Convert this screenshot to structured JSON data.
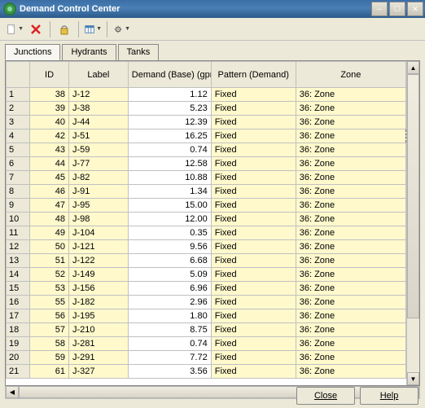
{
  "window": {
    "title": "Demand Control Center"
  },
  "tabs": [
    {
      "label": "Junctions",
      "active": true
    },
    {
      "label": "Hydrants",
      "active": false
    },
    {
      "label": "Tanks",
      "active": false
    }
  ],
  "columns": {
    "id": "ID",
    "label": "Label",
    "demand": "Demand (Base) (gpm)",
    "pattern": "Pattern (Demand)",
    "zone": "Zone"
  },
  "rows": [
    {
      "n": "1",
      "id": "38",
      "label": "J-12",
      "demand": "1.12",
      "pattern": "Fixed",
      "zone": "36: Zone"
    },
    {
      "n": "2",
      "id": "39",
      "label": "J-38",
      "demand": "5.23",
      "pattern": "Fixed",
      "zone": "36: Zone"
    },
    {
      "n": "3",
      "id": "40",
      "label": "J-44",
      "demand": "12.39",
      "pattern": "Fixed",
      "zone": "36: Zone"
    },
    {
      "n": "4",
      "id": "42",
      "label": "J-51",
      "demand": "16.25",
      "pattern": "Fixed",
      "zone": "36: Zone",
      "active": true
    },
    {
      "n": "5",
      "id": "43",
      "label": "J-59",
      "demand": "0.74",
      "pattern": "Fixed",
      "zone": "36: Zone"
    },
    {
      "n": "6",
      "id": "44",
      "label": "J-77",
      "demand": "12.58",
      "pattern": "Fixed",
      "zone": "36: Zone"
    },
    {
      "n": "7",
      "id": "45",
      "label": "J-82",
      "demand": "10.88",
      "pattern": "Fixed",
      "zone": "36: Zone"
    },
    {
      "n": "8",
      "id": "46",
      "label": "J-91",
      "demand": "1.34",
      "pattern": "Fixed",
      "zone": "36: Zone"
    },
    {
      "n": "9",
      "id": "47",
      "label": "J-95",
      "demand": "15.00",
      "pattern": "Fixed",
      "zone": "36: Zone"
    },
    {
      "n": "10",
      "id": "48",
      "label": "J-98",
      "demand": "12.00",
      "pattern": "Fixed",
      "zone": "36: Zone"
    },
    {
      "n": "11",
      "id": "49",
      "label": "J-104",
      "demand": "0.35",
      "pattern": "Fixed",
      "zone": "36: Zone"
    },
    {
      "n": "12",
      "id": "50",
      "label": "J-121",
      "demand": "9.56",
      "pattern": "Fixed",
      "zone": "36: Zone"
    },
    {
      "n": "13",
      "id": "51",
      "label": "J-122",
      "demand": "6.68",
      "pattern": "Fixed",
      "zone": "36: Zone"
    },
    {
      "n": "14",
      "id": "52",
      "label": "J-149",
      "demand": "5.09",
      "pattern": "Fixed",
      "zone": "36: Zone"
    },
    {
      "n": "15",
      "id": "53",
      "label": "J-156",
      "demand": "6.96",
      "pattern": "Fixed",
      "zone": "36: Zone"
    },
    {
      "n": "16",
      "id": "55",
      "label": "J-182",
      "demand": "2.96",
      "pattern": "Fixed",
      "zone": "36: Zone"
    },
    {
      "n": "17",
      "id": "56",
      "label": "J-195",
      "demand": "1.80",
      "pattern": "Fixed",
      "zone": "36: Zone"
    },
    {
      "n": "18",
      "id": "57",
      "label": "J-210",
      "demand": "8.75",
      "pattern": "Fixed",
      "zone": "36: Zone"
    },
    {
      "n": "19",
      "id": "58",
      "label": "J-281",
      "demand": "0.74",
      "pattern": "Fixed",
      "zone": "36: Zone"
    },
    {
      "n": "20",
      "id": "59",
      "label": "J-291",
      "demand": "7.72",
      "pattern": "Fixed",
      "zone": "36: Zone"
    },
    {
      "n": "21",
      "id": "61",
      "label": "J-327",
      "demand": "3.56",
      "pattern": "Fixed",
      "zone": "36: Zone"
    }
  ],
  "buttons": {
    "close": "Close",
    "help": "Help"
  }
}
